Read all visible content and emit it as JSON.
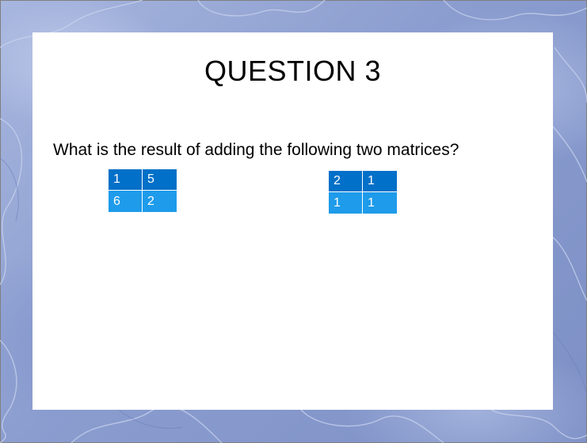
{
  "slide": {
    "title": "QUESTION 3",
    "question": "What is the result of adding the following two matrices?"
  },
  "matrix_a": {
    "rows": [
      [
        "1",
        "5"
      ],
      [
        "6",
        "2"
      ]
    ]
  },
  "matrix_b": {
    "rows": [
      [
        "2",
        "1"
      ],
      [
        "1",
        "1"
      ]
    ]
  },
  "colors": {
    "background": "#8d9fcf",
    "slide": "#ffffff",
    "cell_dark": "#0070c8",
    "cell_light": "#1e9bea"
  }
}
